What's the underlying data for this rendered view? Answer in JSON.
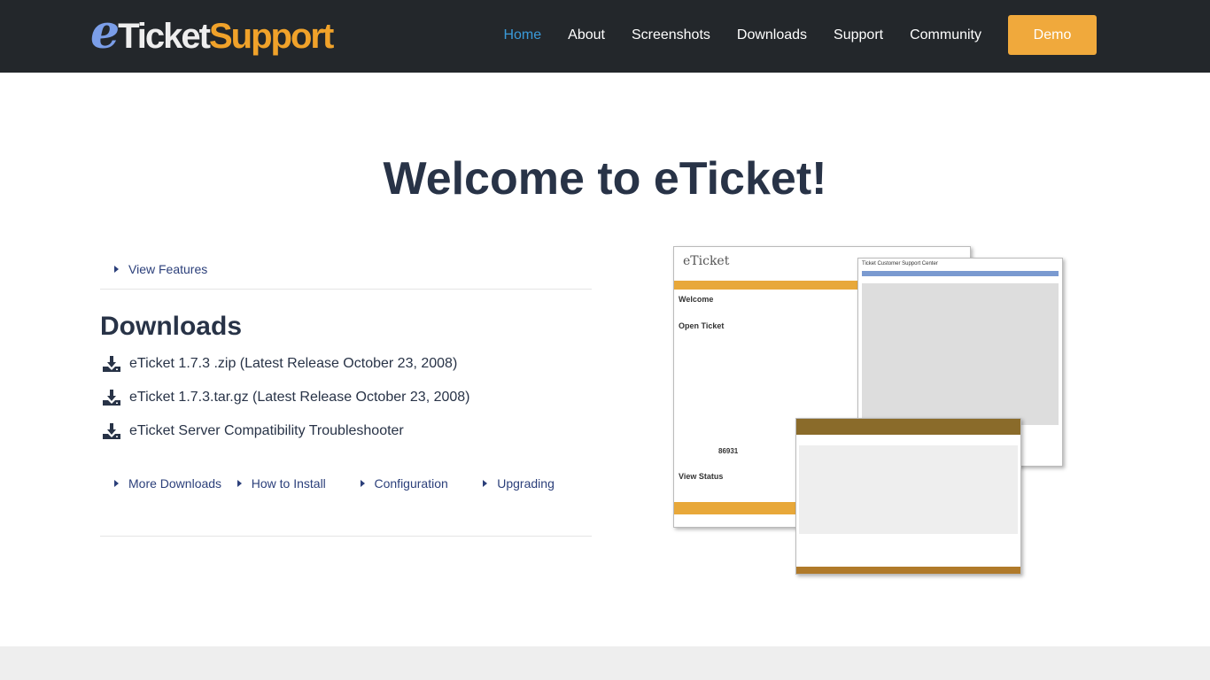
{
  "logo": {
    "e": "e",
    "ticket": "Ticket",
    "support": "Support"
  },
  "nav": {
    "items": [
      "Home",
      "About",
      "Screenshots",
      "Downloads",
      "Support",
      "Community"
    ],
    "active": "Home",
    "demo": "Demo"
  },
  "title": "Welcome to eTicket!",
  "view_features": "View Features",
  "downloads": {
    "heading": "Downloads",
    "items": [
      "eTicket 1.7.3 .zip (Latest Release October 23, 2008)",
      "eTicket 1.7.3.tar.gz (Latest Release October 23, 2008)",
      "eTicket Server Compatibility Troubleshooter"
    ]
  },
  "links": [
    "More Downloads",
    "How to Install",
    "Configuration",
    "Upgrading"
  ],
  "screenshot": {
    "brand": "eTicket",
    "welcome": "Welcome",
    "open_ticket": "Open Ticket",
    "view_status": "View Status",
    "center": "Ticket Customer Support Center",
    "code": "86931"
  },
  "colors": {
    "nav_bg": "#23272b",
    "accent": "#f0a93c",
    "active": "#3a9ad9",
    "link": "#2b3f7a"
  }
}
